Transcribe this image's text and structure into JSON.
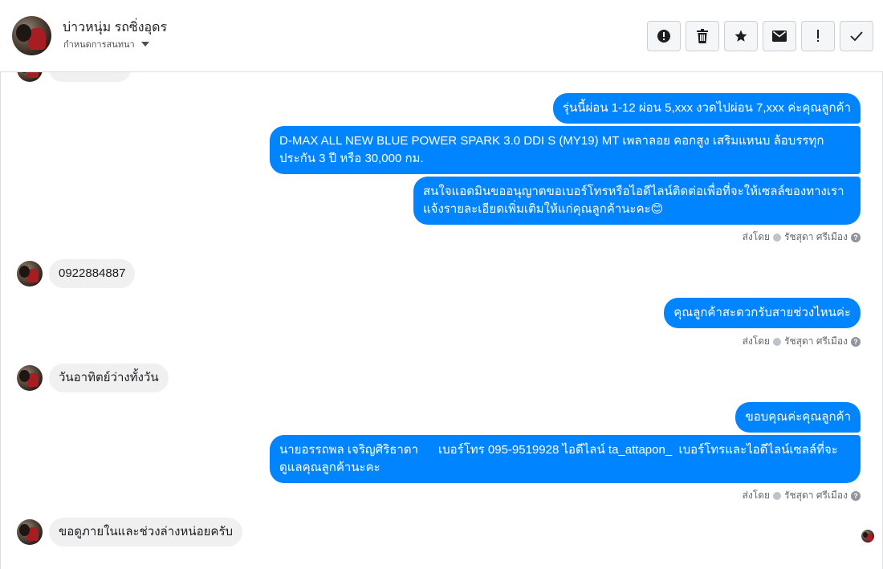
{
  "header": {
    "contact_name": "บ่าวหนุ่ม รถซิ่งอุดร",
    "assign_label": "กำหนดการสนทนา",
    "actions": [
      {
        "icon": "alert-icon",
        "label": "mark-spam"
      },
      {
        "icon": "trash-icon",
        "label": "delete"
      },
      {
        "icon": "star-icon",
        "label": "star"
      },
      {
        "icon": "envelope-icon",
        "label": "mark-unread"
      },
      {
        "icon": "exclamation-icon",
        "label": "follow-up"
      },
      {
        "icon": "check-icon",
        "label": "done"
      }
    ]
  },
  "messages": {
    "out_1": "รุ่นนี้ผ่อน 1-12 ผ่อน 5,xxx งวดไปผ่อน 7,xxx ค่ะคุณลูกค้า",
    "out_2_line1": "D-MAX ALL NEW BLUE POWER SPARK 3.0 DDI S (MY19) MT เพลาลอย คอกสูง เสริมแหนบ ล้อบรรทุก",
    "out_2_line2": "ประกัน 3 ปี หรือ 30,000 กม.",
    "out_3_line1": "สนใจแอดมินขออนุญาตขอเบอร์โทรหรือไอดีไลน์ติดต่อเพื่อที่จะให้เซลล์ของทางเรา",
    "out_3_line2": "แจ้งรายละเอียดเพิ่มเติมให้แก่คุณลูกค้านะคะ😊",
    "in_1": "0922884887",
    "out_4": "คุณลูกค้าสะดวกรับสายช่วงไหนค่ะ",
    "in_2": "วันอาทิตย์ว่างทั้งวัน",
    "out_5": "ขอบคุณค่ะคุณลูกค้า",
    "out_6_line1": "นายอรรถพล เจริญศิริธาดา      เบอร์โทร 095-9519928 ไอดีไลน์ ta_attapon_  เบอร์โทรและไอดีไลน์เซลล์ที่จะ",
    "out_6_line2": "ดูแลคุณลูกค้านะคะ",
    "in_3": "ขอดูภายในและช่วงล่างหน่อยครับ"
  },
  "sent_by": {
    "prefix": "ส่งโดย",
    "agent": "รัชสุดา ศรีเมือง",
    "help": "?"
  },
  "colors": {
    "outgoing": "#0084ff",
    "incoming": "#f1f0f0",
    "border": "#dadde1"
  }
}
